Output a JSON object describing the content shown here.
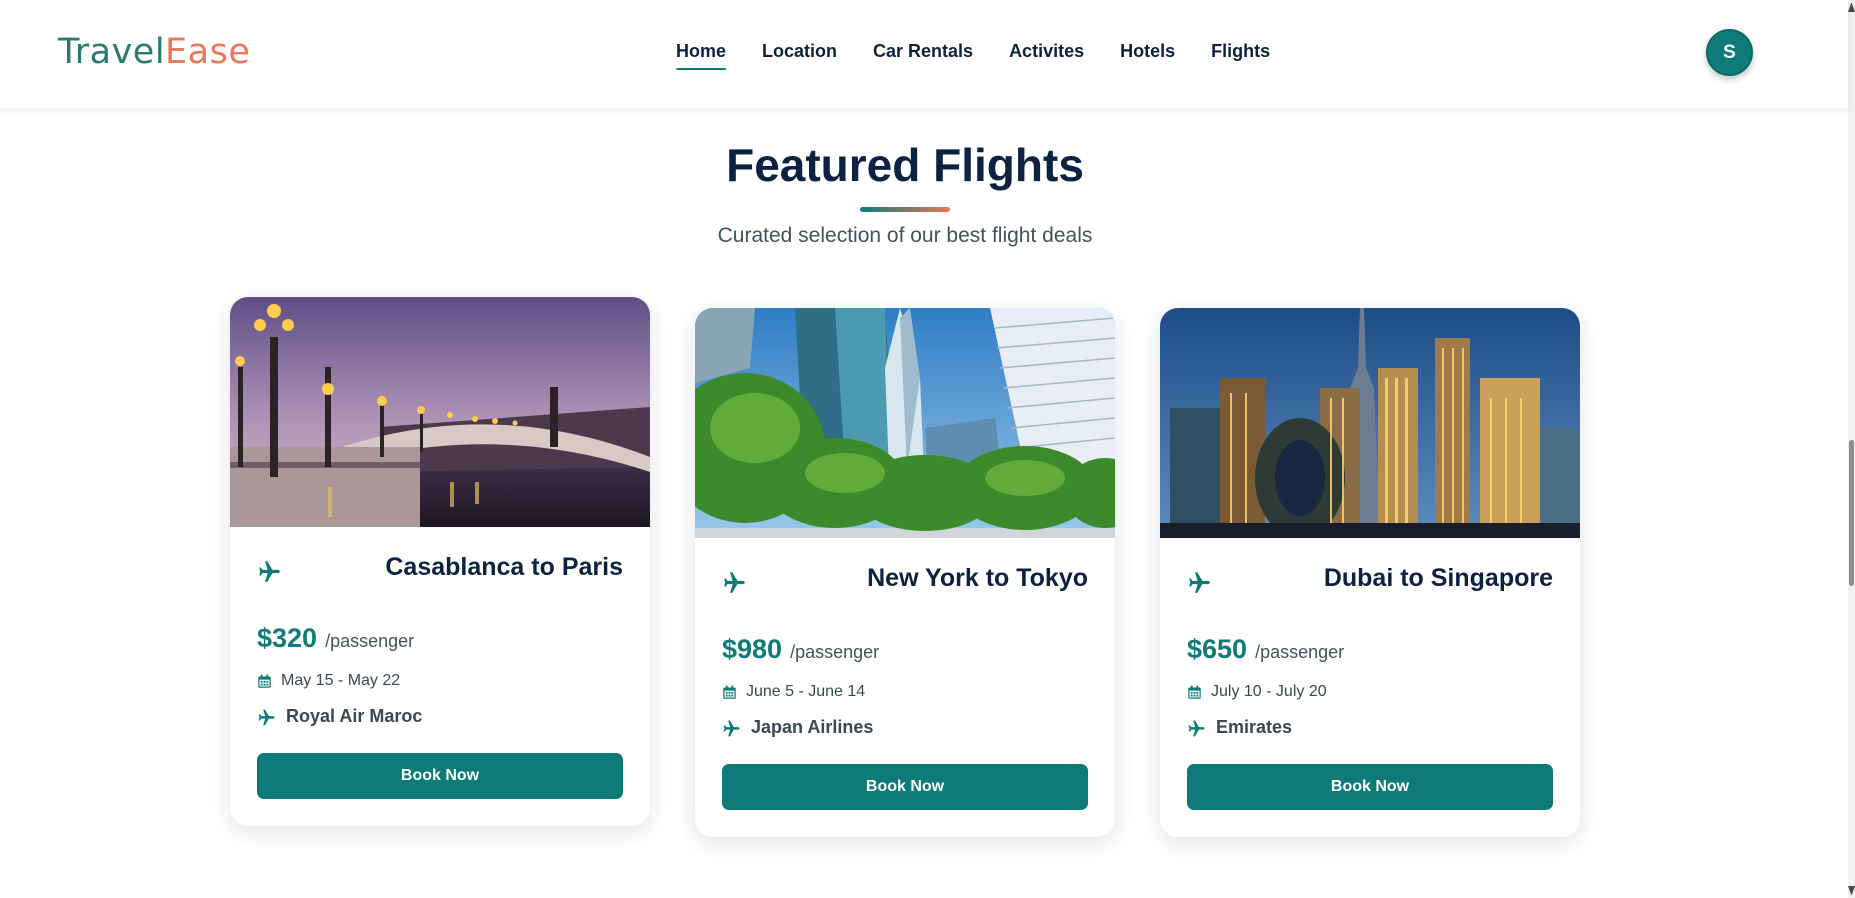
{
  "brand": {
    "part1": "Travel",
    "part2": "Ease"
  },
  "nav": {
    "items": [
      {
        "label": "Home",
        "active": true
      },
      {
        "label": "Location",
        "active": false
      },
      {
        "label": "Car Rentals",
        "active": false
      },
      {
        "label": "Activites",
        "active": false
      },
      {
        "label": "Hotels",
        "active": false
      },
      {
        "label": "Flights",
        "active": false
      }
    ],
    "avatar_initial": "S"
  },
  "section": {
    "title": "Featured Flights",
    "subtitle": "Curated selection of our best flight deals"
  },
  "flights": [
    {
      "route": "Casablanca to Paris",
      "price": "$320",
      "per": "/passenger",
      "dates": "May 15 - May 22",
      "airline": "Royal Air Maroc",
      "button": "Book Now",
      "image_icon": "paris-bridge-photo"
    },
    {
      "route": "New York to Tokyo",
      "price": "$980",
      "per": "/passenger",
      "dates": "June 5 - June 14",
      "airline": "Japan Airlines",
      "button": "Book Now",
      "image_icon": "new-york-skyscrapers-photo"
    },
    {
      "route": "Dubai to Singapore",
      "price": "$650",
      "per": "/passenger",
      "dates": "July 10 - July 20",
      "airline": "Emirates",
      "button": "Book Now",
      "image_icon": "dubai-skyline-photo"
    }
  ],
  "colors": {
    "accent": "#0f7b78",
    "navy": "#0d2240",
    "coral": "#e7775d"
  }
}
